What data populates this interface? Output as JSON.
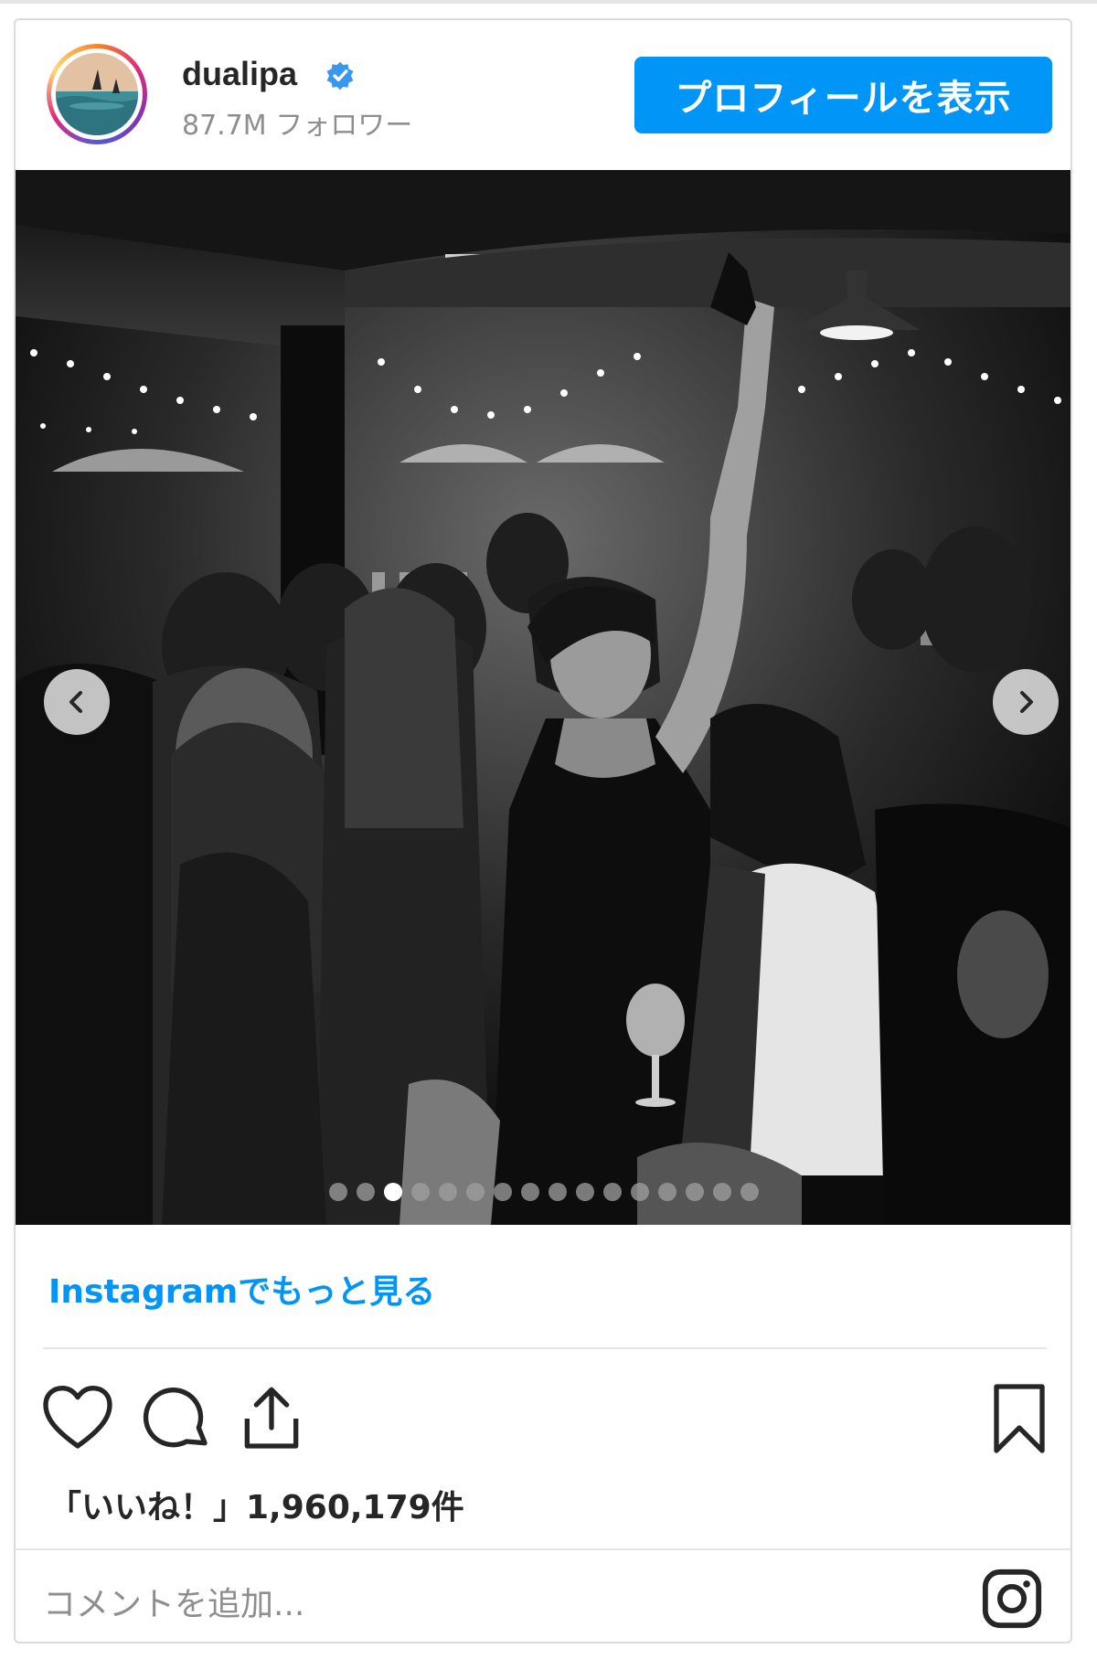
{
  "post": {
    "username": "dualipa",
    "verified": true,
    "followers": "87.7M フォロワー",
    "profile_button": "プロフィールを表示",
    "carousel": {
      "slide_count": 16,
      "active_index": 2
    },
    "more_link": "Instagramでもっと見る",
    "likes_text": "「いいね！」1,960,179件",
    "comment_placeholder": "コメントを追加..."
  },
  "colors": {
    "accent": "#0095f6",
    "border": "#dbdbdb",
    "muted_text": "#8e8e8e"
  },
  "icons": {
    "verified": "verified-badge-icon",
    "prev": "chevron-left-icon",
    "next": "chevron-right-icon",
    "like": "heart-icon",
    "comment": "comment-bubble-icon",
    "share": "share-upload-icon",
    "save": "bookmark-icon",
    "brand": "instagram-icon"
  }
}
